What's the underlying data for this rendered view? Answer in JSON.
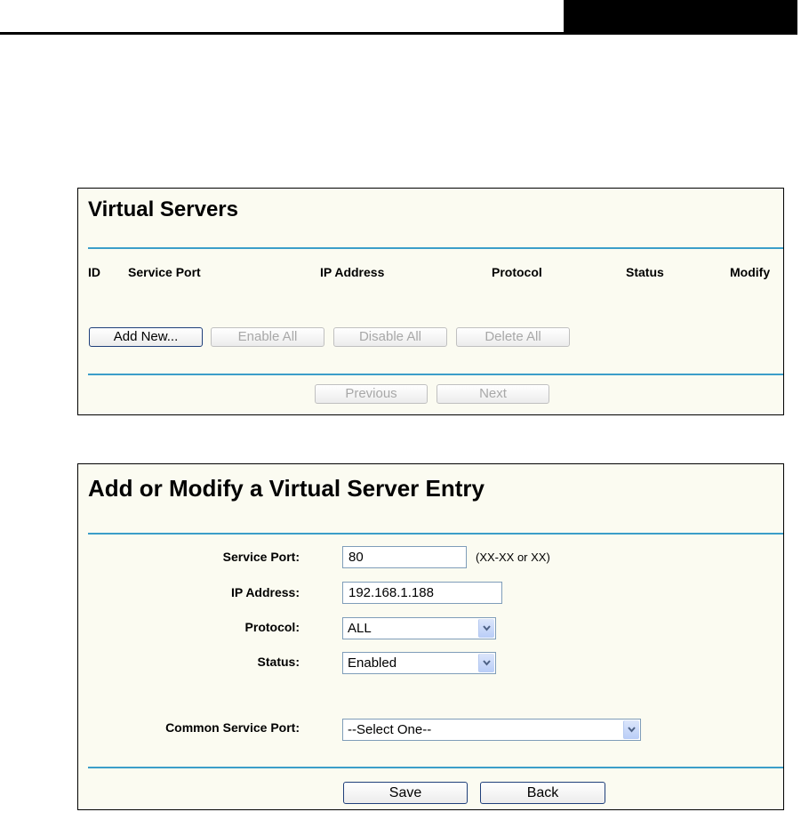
{
  "virtual_servers": {
    "title": "Virtual Servers",
    "columns": [
      "ID",
      "Service Port",
      "IP Address",
      "Protocol",
      "Status",
      "Modify"
    ],
    "buttons": {
      "add_new": "Add New...",
      "enable_all": "Enable All",
      "disable_all": "Disable All",
      "delete_all": "Delete All",
      "previous": "Previous",
      "next": "Next"
    }
  },
  "entry_form": {
    "title": "Add or Modify a Virtual Server Entry",
    "service_port": {
      "label": "Service Port:",
      "value": "80",
      "hint": "(XX-XX or XX)"
    },
    "ip_address": {
      "label": "IP Address:",
      "value": "192.168.1.188"
    },
    "protocol": {
      "label": "Protocol:",
      "value": "ALL"
    },
    "status": {
      "label": "Status:",
      "value": "Enabled"
    },
    "common_service_port": {
      "label": "Common Service Port:",
      "value": "--Select One--"
    },
    "buttons": {
      "save": "Save",
      "back": "Back"
    }
  },
  "colors": {
    "panel_bg": "#fbfbf1",
    "divider": "#3b9ec9"
  }
}
